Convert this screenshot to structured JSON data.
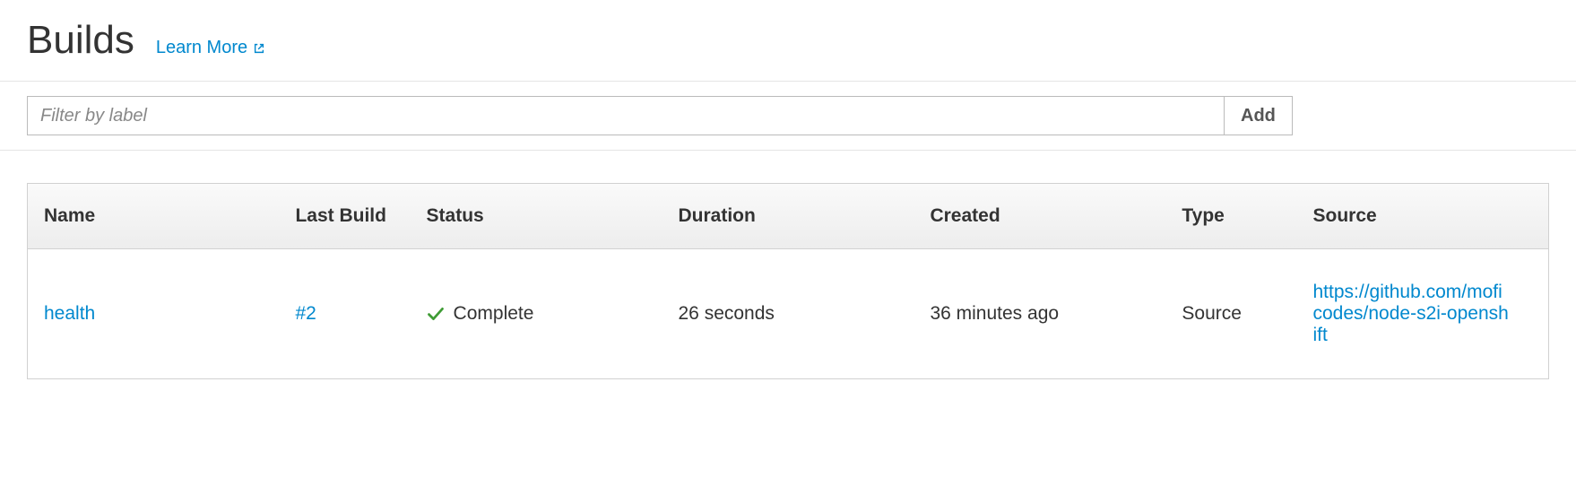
{
  "header": {
    "title": "Builds",
    "learn_more": "Learn More"
  },
  "filter": {
    "placeholder": "Filter by label",
    "add_label": "Add"
  },
  "table": {
    "columns": {
      "name": "Name",
      "last_build": "Last Build",
      "status": "Status",
      "duration": "Duration",
      "created": "Created",
      "type": "Type",
      "source": "Source"
    },
    "rows": [
      {
        "name": "health",
        "last_build": "#2",
        "status": "Complete",
        "duration": "26 seconds",
        "created": "36 minutes ago",
        "type": "Source",
        "source": "https://github.com/moficodes/node-s2i-openshift"
      }
    ]
  }
}
